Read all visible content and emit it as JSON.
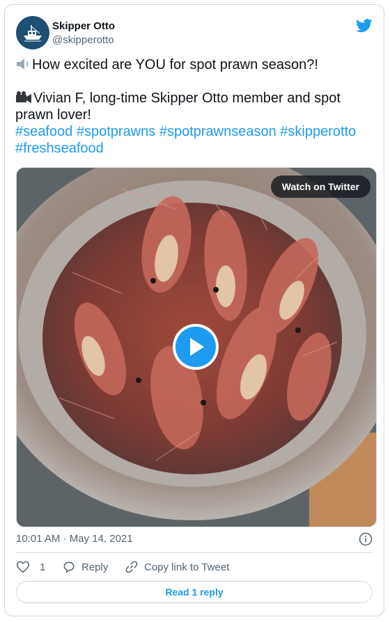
{
  "author": {
    "name": "Skipper Otto",
    "handle": "@skipperotto",
    "avatar_color": "#1d4e73"
  },
  "tweet": {
    "line1_emoji": "speaker-icon",
    "line1_text": "How excited are YOU for spot prawn season?!",
    "line2_emoji": "video-camera-icon",
    "line2_text": "Vivian F, long-time Skipper Otto member and spot prawn lover!",
    "hashtags": [
      "#seafood",
      "#spotprawns",
      "#spotprawnseason",
      "#skipperotto",
      "#freshseafood"
    ]
  },
  "media": {
    "watch_label": "Watch on Twitter",
    "content": "pot of spot prawns"
  },
  "meta": {
    "timestamp": "10:01 AM · May 14, 2021"
  },
  "actions": {
    "like_count": "1",
    "reply_label": "Reply",
    "copy_label": "Copy link to Tweet"
  },
  "footer": {
    "read_replies_label": "Read 1 reply"
  },
  "colors": {
    "link": "#1d9bf0",
    "secondary_text": "#536471",
    "border": "#cfd9de"
  }
}
